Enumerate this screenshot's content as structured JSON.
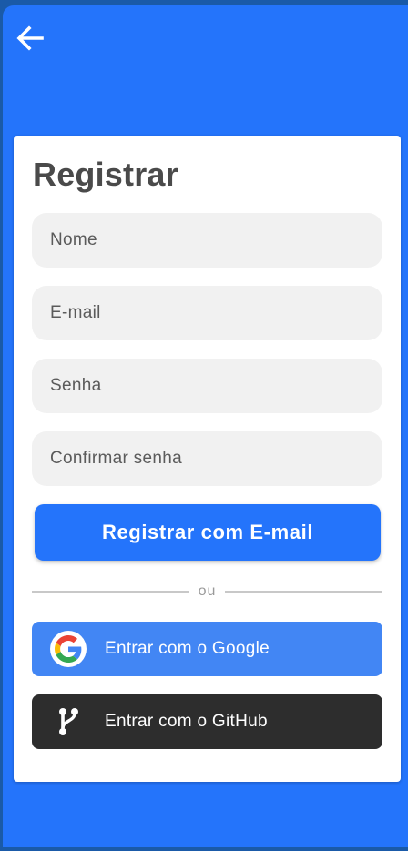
{
  "header": {
    "back_icon": "arrow-left-icon"
  },
  "form": {
    "title": "Registrar",
    "fields": {
      "name_placeholder": "Nome",
      "email_placeholder": "E-mail",
      "password_placeholder": "Senha",
      "confirm_placeholder": "Confirmar senha"
    },
    "submit_label": "Registrar com E-mail",
    "divider_text": "ou",
    "google": {
      "label": "Entrar com o Google",
      "icon": "google-icon"
    },
    "github": {
      "label": "Entrar com o GitHub",
      "icon": "git-branch-icon"
    }
  },
  "colors": {
    "primary": "#2474fb",
    "google": "#4286f4",
    "github": "#2d2d2d",
    "field_bg": "#f1f1f1"
  }
}
